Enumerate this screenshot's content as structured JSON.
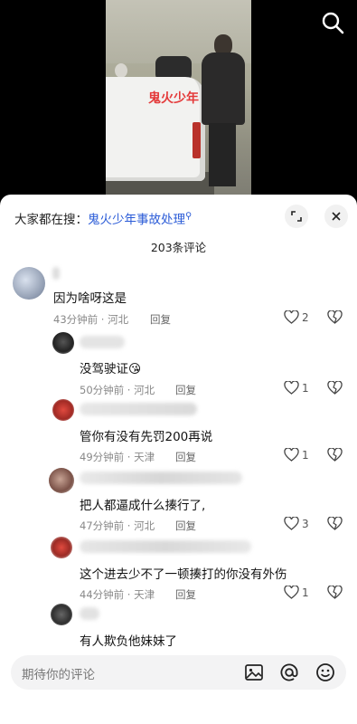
{
  "video": {
    "overlay_text": "鬼火少年"
  },
  "hot_search": {
    "prefix": "大家都在搜：",
    "query": "鬼火少年事故处理"
  },
  "comment_count": "203条评论",
  "comments": [
    {
      "text": "因为啥呀这是",
      "time": "43分钟前",
      "location": "河北",
      "reply_label": "回复",
      "likes": "2"
    },
    {
      "text": "没驾驶证",
      "emoji": "😘",
      "time": "50分钟前",
      "location": "河北",
      "reply_label": "回复",
      "likes": "1"
    },
    {
      "text": "管你有没有先罚200再说",
      "time": "49分钟前",
      "location": "天津",
      "reply_label": "回复",
      "likes": "1"
    },
    {
      "text": "把人都逼成什么揍行了,",
      "time": "47分钟前",
      "location": "河北",
      "reply_label": "回复",
      "likes": "3"
    },
    {
      "text": "这个进去少不了一顿揍打的你没有外伤",
      "time": "44分钟前",
      "location": "天津",
      "reply_label": "回复",
      "likes": "1"
    },
    {
      "text": "有人欺负他妹妹了"
    }
  ],
  "input": {
    "placeholder": "期待你的评论"
  },
  "icons": [
    "search-icon",
    "expand-icon",
    "close-icon",
    "heart-icon",
    "dislike-icon",
    "image-icon",
    "at-icon",
    "emoji-icon"
  ],
  "colors": {
    "link": "#2a5bd7",
    "overlay_text": "#e43a3a",
    "sheet_bg": "#ffffff",
    "input_bg": "#f3f3f4"
  }
}
